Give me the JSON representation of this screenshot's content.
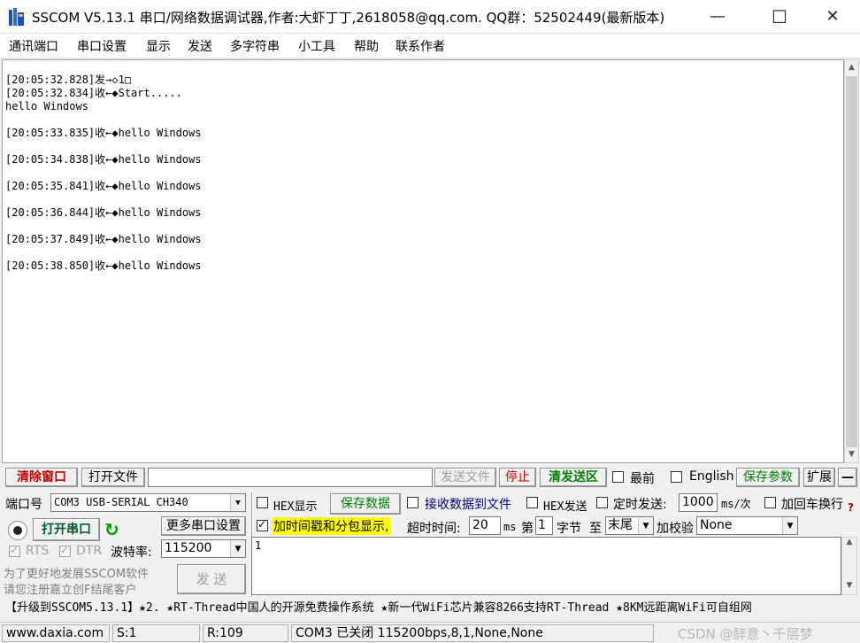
{
  "titlebar": {
    "title": "SSCOM V5.13.1 串口/网络数据调试器,作者:大虾丁丁,2618058@qq.com. QQ群：52502449(最新版本)",
    "minimize": "—",
    "maximize": "☐",
    "close": "✕"
  },
  "menu": [
    "通讯端口",
    "串口设置",
    "显示",
    "发送",
    "多字符串",
    "小工具",
    "帮助",
    "联系作者"
  ],
  "output_lines": [
    "[20:05:32.828]发→◇1□",
    "[20:05:32.834]收←◆Start.....",
    "hello Windows",
    "",
    "[20:05:33.835]收←◆hello Windows",
    "",
    "[20:05:34.838]收←◆hello Windows",
    "",
    "[20:05:35.841]收←◆hello Windows",
    "",
    "[20:05:36.844]收←◆hello Windows",
    "",
    "[20:05:37.849]收←◆hello Windows",
    "",
    "[20:05:38.850]收←◆hello Windows"
  ],
  "toolbar": {
    "clear": "清除窗口",
    "open_file": "打开文件",
    "file_path": "",
    "send_file": "发送文件",
    "stop": "停止",
    "clear_send": "清发送区",
    "topmost": "最前",
    "english": "English",
    "save_params": "保存参数",
    "expand": "扩展",
    "collapse": "—"
  },
  "port": {
    "label": "端口号",
    "value": "COM3 USB-SERIAL CH340",
    "more_settings": "更多串口设置",
    "open_button": "打开串口",
    "rts": "RTS",
    "dtr": "DTR",
    "baud_label": "波特率:",
    "baud_value": "115200"
  },
  "options": {
    "hex_display": "HEX显示",
    "save_data": "保存数据",
    "recv_to_file": "接收数据到文件",
    "hex_send": "HEX发送",
    "timed_send": "定时发送:",
    "interval": "1000",
    "interval_unit": "ms/次",
    "add_crlf": "加回车换行",
    "timestamp": "加时间戳和分包显示,",
    "timeout_label": "超时时间:",
    "timeout_value": "20",
    "timeout_unit": "ms",
    "byte_prefix": "第",
    "byte_index": "1",
    "byte_suffix": "字节",
    "to": "至",
    "end": "末尾",
    "checksum_label": "加校验",
    "checksum_value": "None"
  },
  "send": {
    "text": "1",
    "button": "发 送",
    "promo_line1": "为了更好地发展SSCOM软件",
    "promo_line2": "请您注册嘉立创F结尾客户"
  },
  "ticker": "【升级到SSCOM5.13.1】★2. ★RT-Thread中国人的开源免费操作系统 ★新一代WiFi芯片兼容8266支持RT-Thread ★8KM远距离WiFi可自组网",
  "status": {
    "site": "www.daxia.com",
    "sent": "S:1",
    "recv": "R:109",
    "port_state": "COM3 已关闭  115200bps,8,1,None,None",
    "watermark": "CSDN @醉意丶千层梦"
  }
}
